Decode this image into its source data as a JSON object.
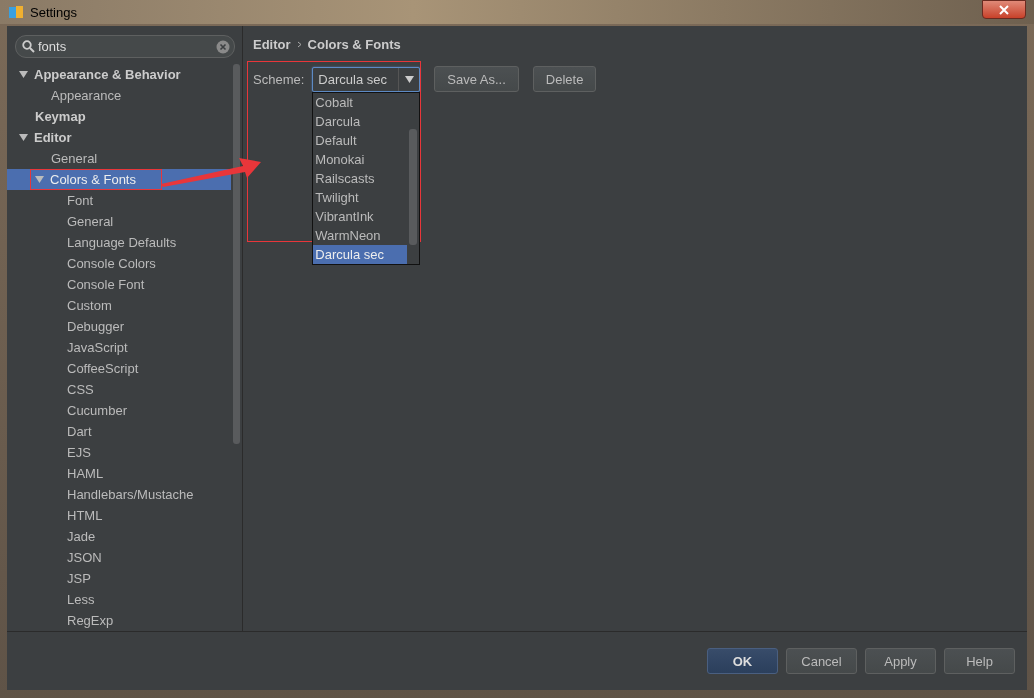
{
  "window": {
    "title": "Settings"
  },
  "search": {
    "value": "fonts"
  },
  "tree": [
    {
      "label": "Appearance & Behavior",
      "bold": true,
      "expanded": true,
      "selected": false,
      "children": [
        {
          "label": "Appearance",
          "bold": false,
          "selected": false
        }
      ]
    },
    {
      "label": "Keymap",
      "bold": true,
      "selected": false
    },
    {
      "label": "Editor",
      "bold": true,
      "expanded": true,
      "selected": false,
      "children": [
        {
          "label": "General",
          "bold": false,
          "selected": false
        },
        {
          "label": "Colors & Fonts",
          "bold": false,
          "expanded": true,
          "selected": true,
          "children": [
            {
              "label": "Font",
              "bold": false,
              "selected": false
            },
            {
              "label": "General",
              "bold": false,
              "selected": false
            },
            {
              "label": "Language Defaults",
              "bold": false,
              "selected": false
            },
            {
              "label": "Console Colors",
              "bold": false,
              "selected": false
            },
            {
              "label": "Console Font",
              "bold": false,
              "selected": false
            },
            {
              "label": "Custom",
              "bold": false,
              "selected": false
            },
            {
              "label": "Debugger",
              "bold": false,
              "selected": false
            },
            {
              "label": "JavaScript",
              "bold": false,
              "selected": false
            },
            {
              "label": "CoffeeScript",
              "bold": false,
              "selected": false
            },
            {
              "label": "CSS",
              "bold": false,
              "selected": false
            },
            {
              "label": "Cucumber",
              "bold": false,
              "selected": false
            },
            {
              "label": "Dart",
              "bold": false,
              "selected": false
            },
            {
              "label": "EJS",
              "bold": false,
              "selected": false
            },
            {
              "label": "HAML",
              "bold": false,
              "selected": false
            },
            {
              "label": "Handlebars/Mustache",
              "bold": false,
              "selected": false
            },
            {
              "label": "HTML",
              "bold": false,
              "selected": false
            },
            {
              "label": "Jade",
              "bold": false,
              "selected": false
            },
            {
              "label": "JSON",
              "bold": false,
              "selected": false
            },
            {
              "label": "JSP",
              "bold": false,
              "selected": false
            },
            {
              "label": "Less",
              "bold": false,
              "selected": false
            },
            {
              "label": "RegExp",
              "bold": false,
              "selected": false
            }
          ]
        }
      ]
    }
  ],
  "breadcrumb": [
    "Editor",
    "Colors & Fonts"
  ],
  "scheme": {
    "label": "Scheme:",
    "value": "Darcula sec",
    "options": [
      {
        "label": "Cobalt",
        "selected": false
      },
      {
        "label": "Darcula",
        "selected": false
      },
      {
        "label": "Default",
        "selected": false
      },
      {
        "label": "Monokai",
        "selected": false
      },
      {
        "label": "Railscasts",
        "selected": false
      },
      {
        "label": "Twilight",
        "selected": false
      },
      {
        "label": "VibrantInk",
        "selected": false
      },
      {
        "label": "WarmNeon",
        "selected": false
      },
      {
        "label": "Darcula sec",
        "selected": true
      }
    ]
  },
  "scheme_buttons": [
    "Save As...",
    "Delete"
  ],
  "buttons": [
    {
      "label": "OK",
      "kind": "default"
    },
    {
      "label": "Cancel",
      "kind": "normal"
    },
    {
      "label": "Apply",
      "kind": "normal"
    },
    {
      "label": "Help",
      "kind": "normal"
    }
  ]
}
